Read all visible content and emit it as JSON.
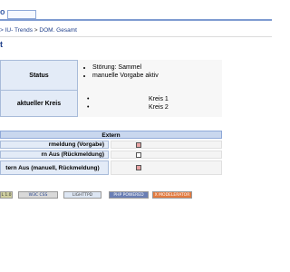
{
  "header": {
    "logo_fragment": "o"
  },
  "breadcrumb": {
    "items": [
      "> IU- Trends",
      "DOM. Gesamt"
    ],
    "separator": ">"
  },
  "page": {
    "title": "t"
  },
  "status": {
    "label": "Status",
    "items": [
      "Störung: Sammel",
      "manuelle Vorgabe aktiv"
    ]
  },
  "kreis": {
    "label": "aktueller Kreis",
    "items": [
      "Kreis 1",
      "Kreis 2"
    ]
  },
  "extern": {
    "header": "Extern",
    "rows": [
      {
        "label": "rmeldung (Vorgabe)",
        "state": "red"
      },
      {
        "label": "rn Aus (Rückmeldung)",
        "state": "white"
      },
      {
        "label": "tern Aus (manuell, Rückmeldung)",
        "state": "red"
      }
    ]
  },
  "footer": {
    "badges": [
      {
        "text": "L 1.0",
        "bg": "#cfcfa0",
        "fg": "#333333"
      },
      {
        "text": "W3C CSS",
        "bg": "#d9d9d9",
        "fg": "#1f3f8a"
      },
      {
        "text": "LIGHTTPD",
        "bg": "#dde6f3",
        "fg": "#444444"
      },
      {
        "text": "PHP POWERED",
        "bg": "#6a7fb5",
        "fg": "#ffffff"
      },
      {
        "text": "X MODELERATOR",
        "bg": "#e27a3f",
        "fg": "#ffffff"
      }
    ]
  },
  "colors": {
    "accent": "#1f3f8a",
    "label_bg": "#e3ebf7",
    "header_bg": "#c9d7ee",
    "indicator_red": "#e7a3a3"
  }
}
